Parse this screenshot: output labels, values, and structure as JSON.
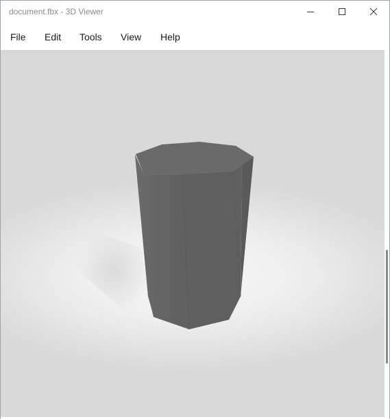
{
  "window": {
    "title": "document.fbx - 3D Viewer",
    "controls": [
      "minimize",
      "maximize",
      "close"
    ]
  },
  "menu": {
    "items": [
      {
        "label": "File"
      },
      {
        "label": "Edit"
      },
      {
        "label": "Tools"
      },
      {
        "label": "View"
      },
      {
        "label": "Help"
      }
    ]
  },
  "viewport": {
    "model": "octagonal-prism",
    "model_color": "#5e5e5e",
    "background_color": "#e6e6e6"
  },
  "icons": {
    "minimize": "minimize-icon",
    "maximize": "maximize-icon",
    "close": "close-icon"
  }
}
